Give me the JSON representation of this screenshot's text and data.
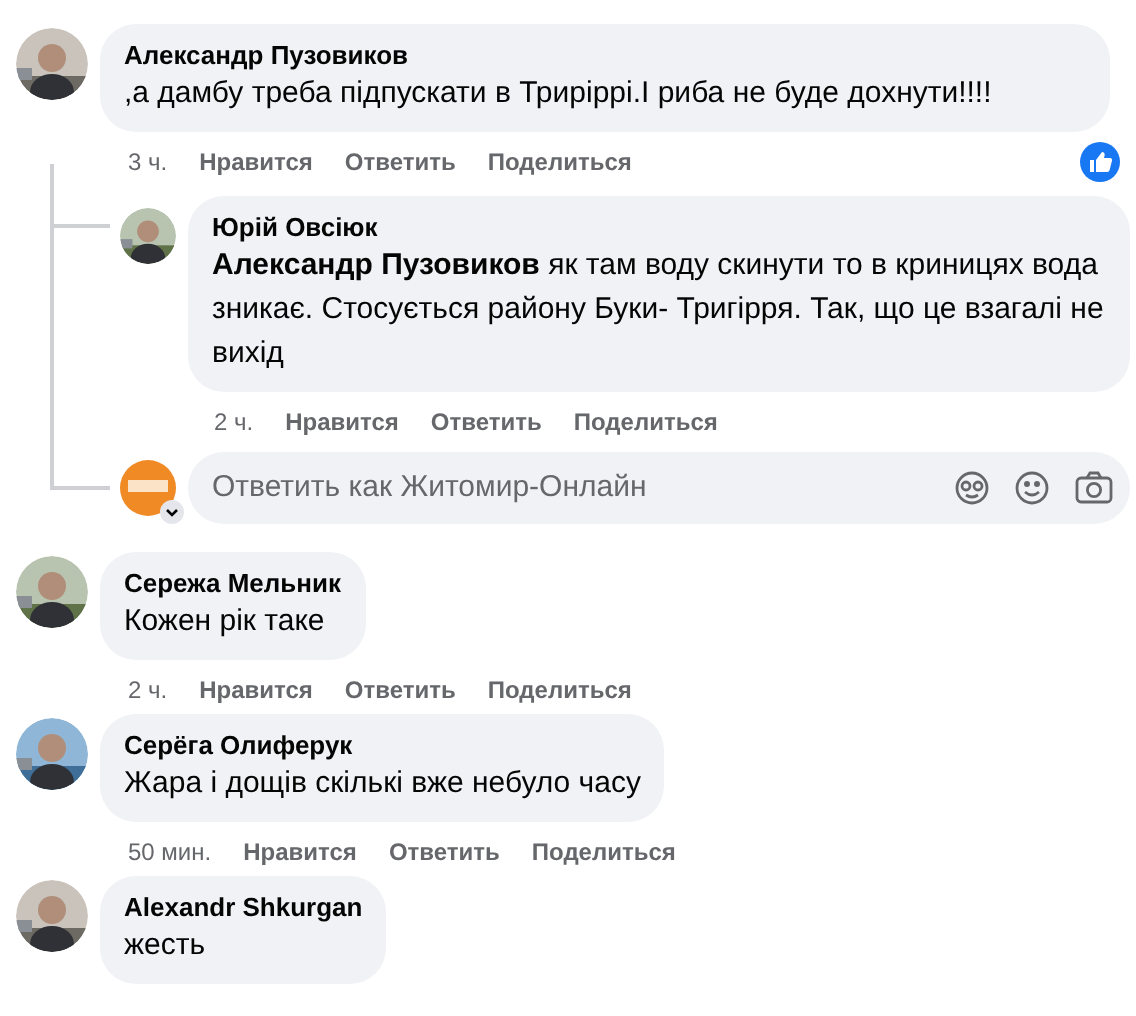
{
  "comments": [
    {
      "author": "Александр Пузовиков",
      "text": ",а дамбу треба підпускати в Триріррі.І риба не буде дохнути!!!!",
      "time": "3 ч.",
      "actions": [
        "Нравится",
        "Ответить",
        "Поделиться"
      ],
      "liked": true,
      "replies": [
        {
          "author": "Юрій Овсіюк",
          "text": "**Александр Пузовиков** як там воду скинути то в криницях вода зникає. Стосується району Буки- Тригірря. Так, що це взагалі не вихід",
          "time": "2 ч.",
          "actions": [
            "Нравится",
            "Ответить",
            "Поделиться"
          ],
          "liked": false
        }
      ],
      "reply_box": {
        "placeholder": "Ответить как Житомир-Онлайн"
      }
    },
    {
      "author": "Сережа Мельник",
      "text": "Кожен рік таке",
      "time": "2 ч.",
      "actions": [
        "Нравится",
        "Ответить",
        "Поделиться"
      ],
      "liked": false
    },
    {
      "author": "Серёга Олиферук",
      "text": "Жара і дощів скількі вже небуло часу",
      "time": "50 мин.",
      "actions": [
        "Нравится",
        "Ответить",
        "Поделиться"
      ],
      "liked": false
    },
    {
      "author": "Alexandr Shkurgan",
      "text": "жесть"
    }
  ]
}
